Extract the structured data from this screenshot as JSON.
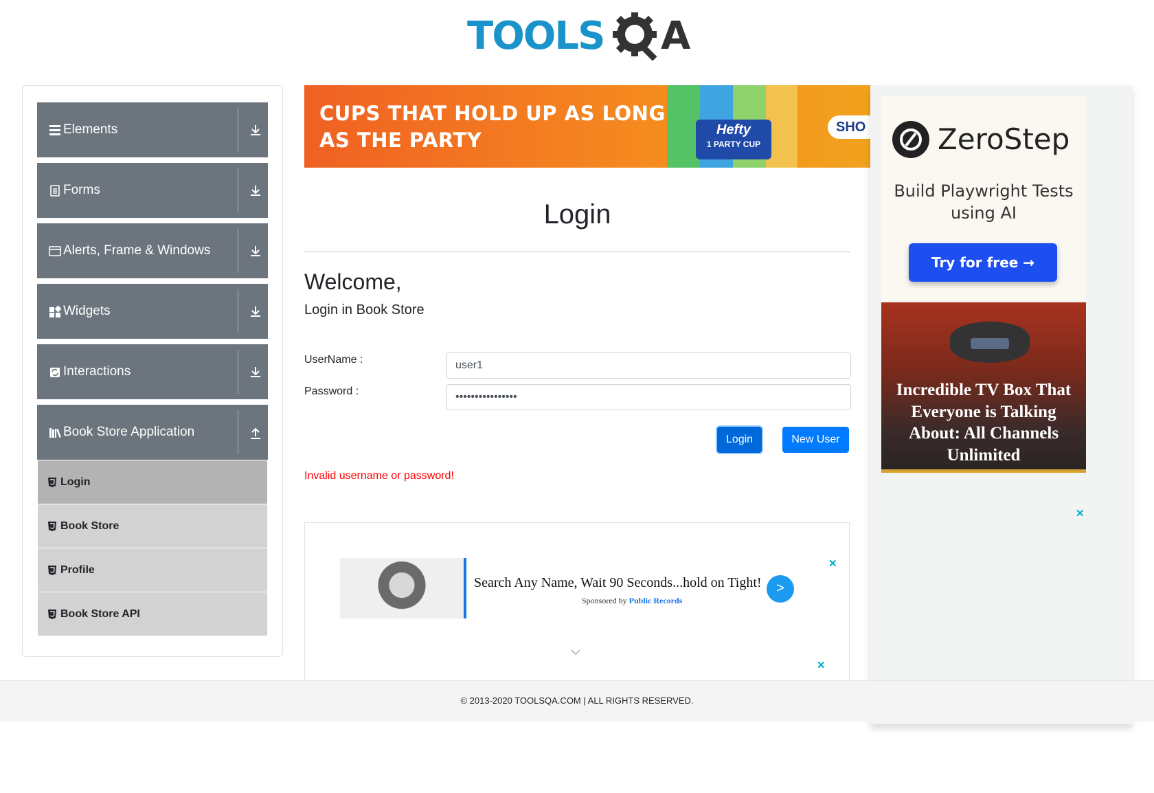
{
  "header": {
    "logo_text_tools": "TOOLS",
    "logo_text_q": "Q",
    "logo_text_a": "A"
  },
  "sidebar": {
    "groups": [
      {
        "label": "Elements",
        "icon": "menu-icon",
        "arrow": "download-icon"
      },
      {
        "label": "Forms",
        "icon": "document-icon",
        "arrow": "download-icon"
      },
      {
        "label": "Alerts, Frame & Windows",
        "icon": "window-icon",
        "arrow": "download-icon"
      },
      {
        "label": "Widgets",
        "icon": "widgets-icon",
        "arrow": "download-icon"
      },
      {
        "label": "Interactions",
        "icon": "interactions-icon",
        "arrow": "download-icon"
      },
      {
        "label": "Book Store Application",
        "icon": "books-icon",
        "arrow": "upload-icon"
      }
    ],
    "subitems": [
      {
        "label": "Login",
        "icon": "html5-icon",
        "active": true
      },
      {
        "label": "Book Store",
        "icon": "html5-icon",
        "active": false
      },
      {
        "label": "Profile",
        "icon": "html5-icon",
        "active": false
      },
      {
        "label": "Book Store API",
        "icon": "html5-icon",
        "active": false
      }
    ]
  },
  "banner_ad": {
    "headline": "CUPS THAT HOLD UP AS LONG AS THE PARTY",
    "brand": "Hefty",
    "brand_sub": "1 PARTY CUP",
    "cta": "SHO"
  },
  "main": {
    "title": "Login",
    "welcome": "Welcome,",
    "subtitle": "Login in Book Store",
    "username_label": "UserName :",
    "username_value": "user1",
    "password_label": "Password :",
    "password_value": "••••••••••••••••",
    "login_button": "Login",
    "new_user_button": "New User",
    "error_message": "Invalid username or password!"
  },
  "native_ad": {
    "headline": "Search Any Name, Wait 90 Seconds...hold on Tight!",
    "sponsored_prefix": "Sponsored by",
    "sponsor": "Public Records",
    "go_label": ">",
    "close_label": "✕"
  },
  "right_ads": {
    "zerostep_brand": "ZeroStep",
    "zerostep_tagline": "Build Playwright Tests using AI",
    "zerostep_cta": "Try for free →",
    "tv_headline": "Incredible TV Box That Everyone is Talking About: All Channels Unlimited",
    "close_label": "✕"
  },
  "footer": {
    "text": "© 2013-2020 TOOLSQA.COM | ALL RIGHTS RESERVED."
  },
  "colors": {
    "sidebar_group": "#6c757d",
    "submenu": "#d2d2d2",
    "submenu_active": "#b3b3b3",
    "primary": "#007bff",
    "error": "#ff0000",
    "logo_blue": "#1993c9",
    "logo_dark": "#333333"
  }
}
